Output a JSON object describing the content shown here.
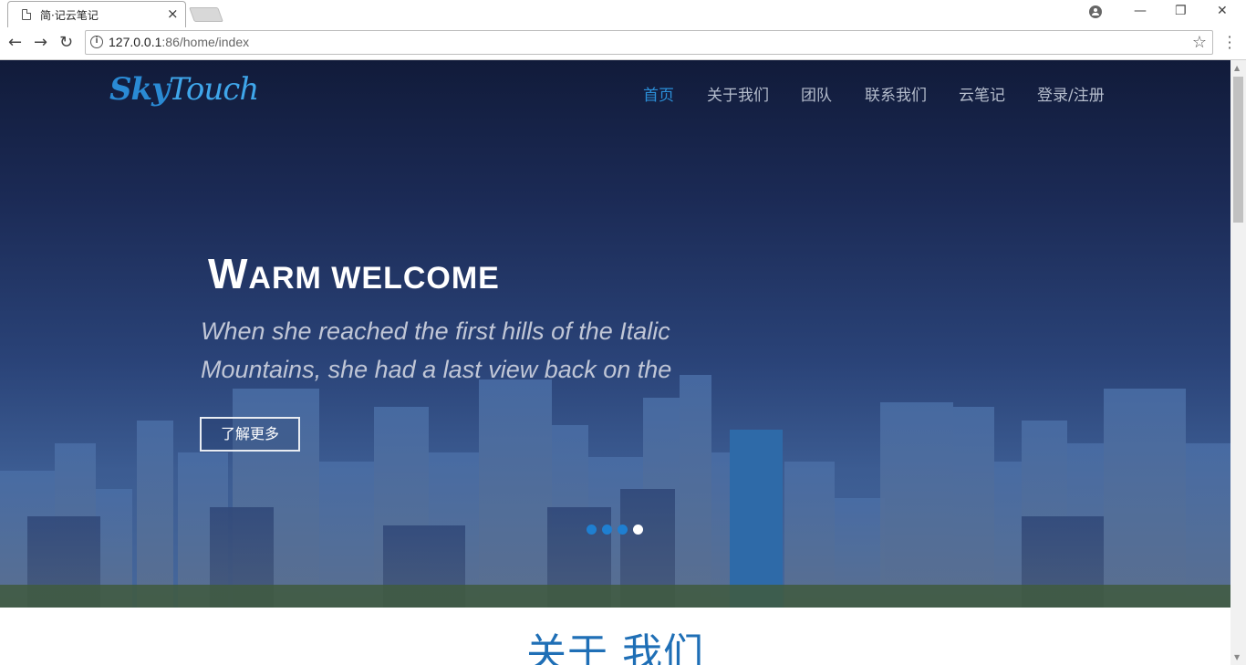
{
  "browser": {
    "tab_title": "简·记云笔记",
    "tab_close": "×",
    "url_host": "127.0.0.1",
    "url_path": ":86/home/index",
    "window_minimize": "—",
    "window_restore": "❐",
    "window_close": "✕",
    "back": "←",
    "forward": "→",
    "reload": "↻",
    "info": "i",
    "bookmark": "☆"
  },
  "site": {
    "logo_part1": "Sky",
    "logo_part2": "Touch",
    "nav": [
      {
        "label": "首页",
        "active": true
      },
      {
        "label": "关于我们",
        "active": false
      },
      {
        "label": "团队",
        "active": false
      },
      {
        "label": "联系我们",
        "active": false
      },
      {
        "label": "云笔记",
        "active": false
      },
      {
        "label": "登录/注册",
        "active": false
      }
    ]
  },
  "hero": {
    "title_cap": "W",
    "title_rest": "ARM WELCOME",
    "subtitle": "When she reached the first hills of the Italic Mountains, she had a last view back on the",
    "button": "了解更多",
    "slides": 4,
    "active_slide": 4
  },
  "about": {
    "title": "关于 我们"
  },
  "colors": {
    "accent": "#2b8fd8",
    "about_title": "#1f6fb6",
    "hero_top": "#111b3a",
    "hero_bottom": "#46689c"
  }
}
